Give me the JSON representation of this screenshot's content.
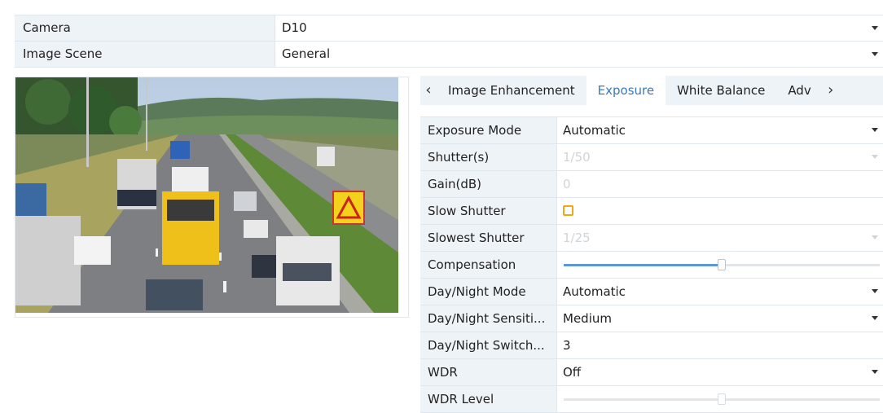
{
  "camera": {
    "label": "Camera",
    "value": "D10"
  },
  "scene": {
    "label": "Image Scene",
    "value": "General"
  },
  "tabs": {
    "items": [
      {
        "label": "Image Enhancement"
      },
      {
        "label": "Exposure"
      },
      {
        "label": "White Balance"
      },
      {
        "label": "Adv"
      }
    ],
    "active": "Exposure",
    "prev_icon": "chevron-left-icon",
    "next_icon": "chevron-right-icon"
  },
  "settings": {
    "exposure_mode": {
      "label": "Exposure Mode",
      "value": "Automatic"
    },
    "shutter": {
      "label": "Shutter(s)",
      "value": "1/50"
    },
    "gain": {
      "label": "Gain(dB)",
      "value": "0"
    },
    "slow_shutter": {
      "label": "Slow Shutter",
      "checked": false
    },
    "slowest_shutter": {
      "label": "Slowest Shutter",
      "value": "1/25"
    },
    "compensation": {
      "label": "Compensation",
      "level": 0.5
    },
    "day_night_mode": {
      "label": "Day/Night Mode",
      "value": "Automatic"
    },
    "day_night_sensitivity": {
      "label": "Day/Night Sensiti...",
      "value": "Medium"
    },
    "day_night_switch": {
      "label": "Day/Night Switch...",
      "value": "3"
    },
    "wdr": {
      "label": "WDR",
      "value": "Off"
    },
    "wdr_level": {
      "label": "WDR Level",
      "level": 0.5
    }
  },
  "colors": {
    "accent": "#3b78c4",
    "label_bg": "#eef3f8",
    "checkbox": "#f2a51a",
    "slider_fill": "#5b97d6"
  }
}
